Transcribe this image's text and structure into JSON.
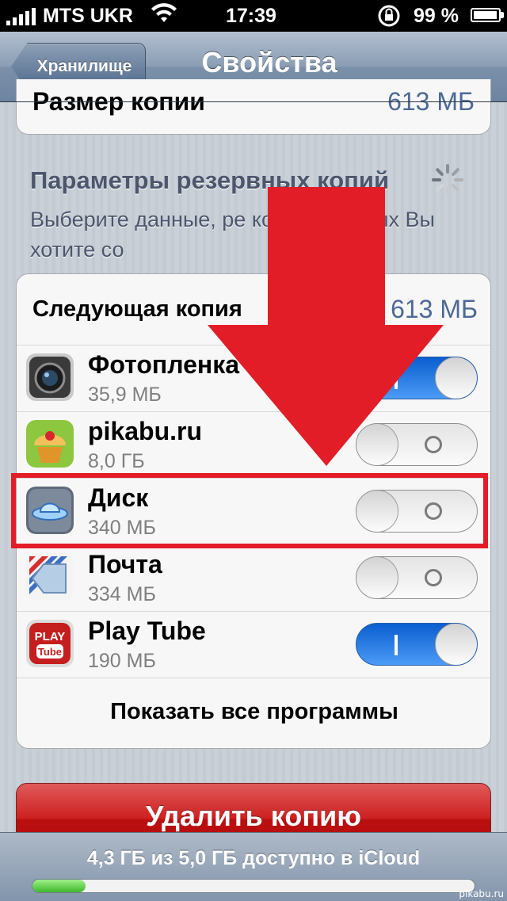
{
  "status_bar": {
    "carrier": "MTS UKR",
    "time": "17:39",
    "battery": "99 %"
  },
  "nav": {
    "back_label": "Хранилище",
    "title": "Свойства"
  },
  "backup_size": {
    "label": "Размер копии",
    "value": "613 МБ"
  },
  "section": {
    "title": "Параметры резервных копий",
    "description": "Выберите данные, ре копию которых Вы хотите со"
  },
  "next_backup": {
    "label": "Следующая копия",
    "value": "613 МБ"
  },
  "apps": [
    {
      "name": "Фотопленка",
      "size": "35,9 МБ",
      "enabled": true,
      "icon": "camera-icon"
    },
    {
      "name": "pikabu.ru",
      "size": "8,0 ГБ",
      "enabled": false,
      "icon": "pikabu-cupcake-icon"
    },
    {
      "name": "Диск",
      "size": "340 МБ",
      "enabled": false,
      "icon": "ufo-disk-icon"
    },
    {
      "name": "Почта",
      "size": "334 МБ",
      "enabled": false,
      "icon": "mail-envelope-icon"
    },
    {
      "name": "Play Tube",
      "size": "190 МБ",
      "enabled": true,
      "icon": "play-tube-icon"
    }
  ],
  "show_all_label": "Показать все программы",
  "delete_label": "Удалить копию",
  "storage": {
    "text": "4,3 ГБ из 5,0 ГБ доступно в iCloud",
    "used_fraction": 0.12
  },
  "watermark": "pikabu.ru",
  "colors": {
    "highlight_red": "#e31d28",
    "toggle_on_blue": "#1f74e6",
    "value_blue": "#4d6a96"
  }
}
